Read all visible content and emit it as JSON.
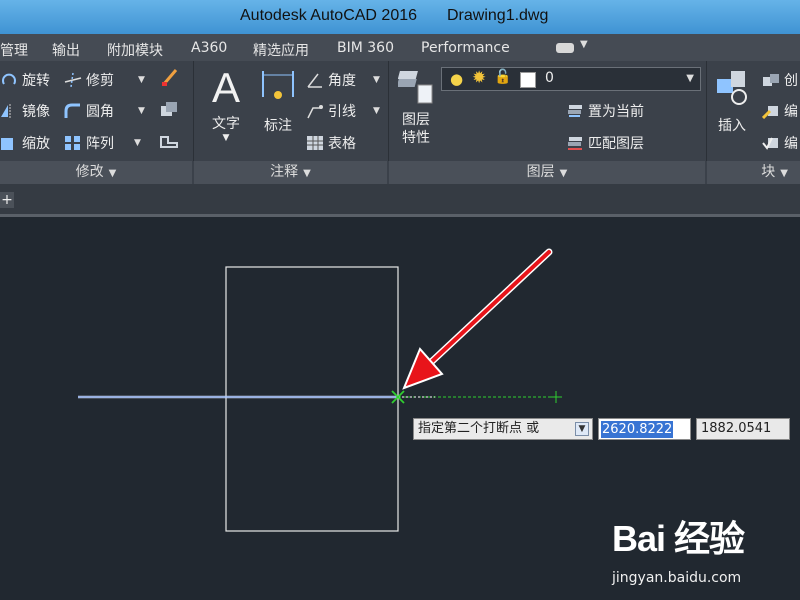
{
  "window": {
    "app_title": "Autodesk AutoCAD 2016",
    "file_name": "Drawing1.dwg"
  },
  "menu_tabs": [
    "管理",
    "输出",
    "附加模块",
    "A360",
    "精选应用",
    "BIM 360",
    "Performance"
  ],
  "ribbon": {
    "modify": {
      "title": "修改",
      "rotate": "旋转",
      "trim": "修剪",
      "mirror": "镜像",
      "fillet": "圆角",
      "scale": "缩放",
      "array": "阵列"
    },
    "annotation": {
      "title": "注释",
      "text": "文字",
      "dimension": "标注",
      "angular": "角度",
      "leader": "引线",
      "table": "表格"
    },
    "layers": {
      "title": "图层",
      "properties_line1": "图层",
      "properties_line2": "特性",
      "current_layer": "0",
      "make_current": "置为当前",
      "match_layer": "匹配图层"
    },
    "block": {
      "title": "块",
      "insert": "插入",
      "create": "创",
      "edit1": "编",
      "edit2": "编"
    }
  },
  "tab_strip": {
    "plus": "+"
  },
  "command_input": {
    "prompt": "指定第二个打断点 或",
    "x_value": "2620.8222",
    "y_value": "1882.0541"
  },
  "watermark": {
    "logo": "Bai 经验",
    "url": "jingyan.baidu.com"
  },
  "colors": {
    "title_bar": "#4ea4df",
    "canvas_background": "#212830",
    "selected_line": "#a7c3ff",
    "arrow_red": "#e8141a",
    "snap_green": "#2fd02f"
  }
}
